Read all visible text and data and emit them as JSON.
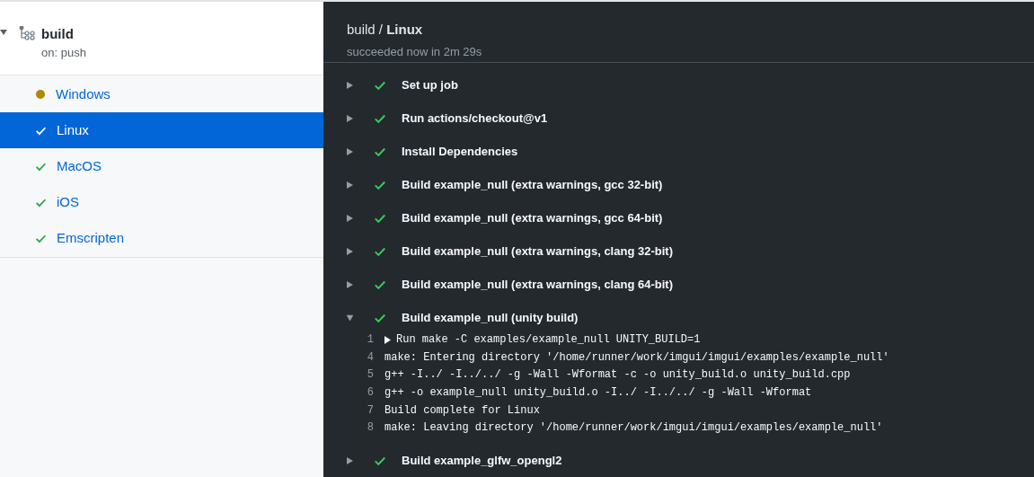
{
  "workflow": {
    "name": "build",
    "trigger": "on: push",
    "expanded": true
  },
  "jobs": [
    {
      "name": "Windows",
      "kind": "in_progress",
      "selected": false
    },
    {
      "name": "Linux",
      "kind": "success",
      "selected": true
    },
    {
      "name": "MacOS",
      "kind": "success",
      "selected": false
    },
    {
      "name": "iOS",
      "kind": "success",
      "selected": false
    },
    {
      "name": "Emscripten",
      "kind": "success",
      "selected": false
    }
  ],
  "header": {
    "title": "build / **Linux**",
    "summary": "succeeded now in 2m 29s"
  },
  "steps": [
    {
      "name": "Set up job",
      "kind": "success",
      "expanded": false
    },
    {
      "name": "Run actions/checkout@v1",
      "kind": "success",
      "expanded": false
    },
    {
      "name": "Install Dependencies",
      "kind": "success",
      "expanded": false
    },
    {
      "name": "Build example_null (extra warnings, gcc 32-bit)",
      "kind": "success",
      "expanded": false
    },
    {
      "name": "Build example_null (extra warnings, gcc 64-bit)",
      "kind": "success",
      "expanded": false
    },
    {
      "name": "Build example_null (extra warnings, clang 32-bit)",
      "kind": "success",
      "expanded": false
    },
    {
      "name": "Build example_null (extra warnings, clang 64-bit)",
      "kind": "success",
      "expanded": false
    },
    {
      "name": "Build example_null (unity build)",
      "kind": "success",
      "expanded": true,
      "log": [
        {
          "number": "1",
          "text": "Run make -C examples/example_null UNITY_BUILD=1",
          "kind": "group"
        },
        {
          "number": "4",
          "text": "make: Entering directory '/home/runner/work/imgui/imgui/examples/example_null'",
          "kind": "line"
        },
        {
          "number": "5",
          "text": "g++ -I../ -I../../ -g -Wall -Wformat -c -o unity_build.o unity_build.cpp",
          "kind": "line"
        },
        {
          "number": "6",
          "text": "g++ -o example_null unity_build.o -I../ -I../../ -g -Wall -Wformat",
          "kind": "line"
        },
        {
          "number": "7",
          "text": "Build complete for Linux",
          "kind": "line"
        },
        {
          "number": "8",
          "text": "make: Leaving directory '/home/runner/work/imgui/imgui/examples/example_null'",
          "kind": "line"
        }
      ]
    },
    {
      "name": "Build example_glfw_opengl2",
      "kind": "success",
      "expanded": false
    }
  ]
}
